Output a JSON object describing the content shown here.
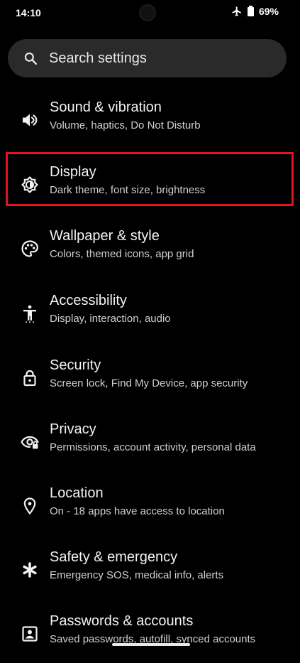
{
  "status_bar": {
    "time": "14:10",
    "battery": "69%",
    "icons": [
      "airplane-mode-icon",
      "battery-icon"
    ]
  },
  "search": {
    "placeholder": "Search settings"
  },
  "settings": [
    {
      "title": "Sound & vibration",
      "subtitle": "Volume, haptics, Do Not Disturb",
      "icon": "volume-icon"
    },
    {
      "title": "Display",
      "subtitle": "Dark theme, font size, brightness",
      "icon": "brightness-icon"
    },
    {
      "title": "Wallpaper & style",
      "subtitle": "Colors, themed icons, app grid",
      "icon": "palette-icon"
    },
    {
      "title": "Accessibility",
      "subtitle": "Display, interaction, audio",
      "icon": "accessibility-icon"
    },
    {
      "title": "Security",
      "subtitle": "Screen lock, Find My Device, app security",
      "icon": "lock-icon"
    },
    {
      "title": "Privacy",
      "subtitle": "Permissions, account activity, personal data",
      "icon": "privacy-eye-icon"
    },
    {
      "title": "Location",
      "subtitle": "On - 18 apps have access to location",
      "icon": "location-pin-icon"
    },
    {
      "title": "Safety & emergency",
      "subtitle": "Emergency SOS, medical info, alerts",
      "icon": "emergency-asterisk-icon"
    },
    {
      "title": "Passwords & accounts",
      "subtitle": "Saved passwords, autofill, synced accounts",
      "icon": "account-box-icon"
    }
  ],
  "highlighted_item": "Display",
  "colors": {
    "background": "#000000",
    "search_background": "#2a2a2a",
    "highlight": "#e3141d",
    "text_primary": "#f3f3f3",
    "text_secondary": "#d0d0d0"
  }
}
